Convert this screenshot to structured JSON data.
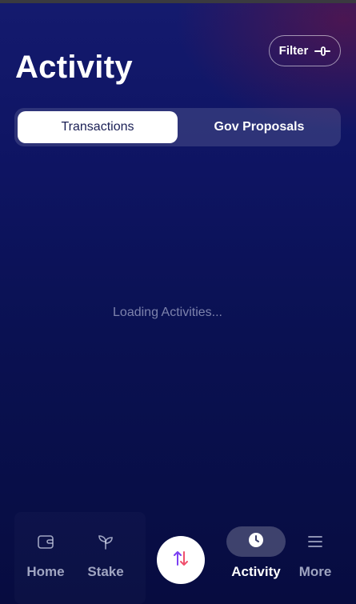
{
  "header": {
    "title": "Activity",
    "filter_label": "Filter"
  },
  "tabs": [
    {
      "label": "Transactions",
      "active": true
    },
    {
      "label": "Gov Proposals",
      "active": false
    }
  ],
  "content": {
    "loading_text": "Loading Activities..."
  },
  "bottom_nav": {
    "items": [
      {
        "label": "Home",
        "icon": "wallet-icon"
      },
      {
        "label": "Stake",
        "icon": "sprout-icon"
      },
      {
        "label": "Activity",
        "icon": "clock-icon",
        "active": true
      },
      {
        "label": "More",
        "icon": "menu-icon"
      }
    ],
    "center_action_icon": "swap-arrows-icon"
  },
  "colors": {
    "background_top": "#141a6e",
    "background_bottom": "#070c40",
    "swap_arrow_up": "#7b3ff2",
    "swap_arrow_down": "#f0506e"
  }
}
